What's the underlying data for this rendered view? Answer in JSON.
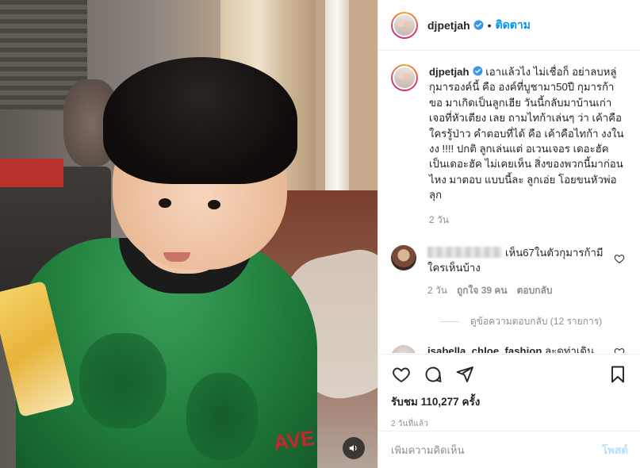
{
  "post": {
    "username": "djpetjah",
    "follow_label": "ติดตาม",
    "separator": "•",
    "caption": "เอาแล้วไง ไม่เชื่อก็ อย่าลบหลู่ กุมารองค์นี้ คือ องค์ที่บูชามา50ปี กุมารก้าขอ มาเกิดเป็นลูกเฮีย วันนี้กลับมาบ้านเก่า เจอที่หัวเตียง เลย ถามไทก้าเล่นๆ ว่า เค้าคือใครรู้ป่าว คำตอบที่ได้ คือ เค้าคือไทก้า งงในงง !!!! ปกติ ลูกเล่นแต่ อเวนเจอร เดอะฮัค เป็นเดอะฮัค ไม่เคยเห็น สิ่งของพวกนี้มาก่อน ไหง มาตอบ แบบนี้ละ ลูกเอ่ย โอยขนหัวพ่อลุก",
    "caption_age": "2 วัน"
  },
  "comments": [
    {
      "username_hidden": true,
      "text": "เห็น67ในตัวกุมารก้ามีใครเห็นบ้าง",
      "age": "2 วัน",
      "likes": "ถูกใจ 39 คน",
      "reply_label": "ตอบกลับ",
      "view_replies": "ดูข้อความตอบกลับ (12 รายการ)"
    },
    {
      "username": "isabella_chloe_fashion",
      "text": "ละดท่าเดิน"
    }
  ],
  "actions": {
    "like_icon": "heart-icon",
    "comment_icon": "comment-icon",
    "share_icon": "share-icon",
    "save_icon": "bookmark-icon",
    "views_text": "รับชม 110,277 ครั้ง",
    "timestamp": "2 วันที่แล้ว"
  },
  "composer": {
    "placeholder": "เพิ่มความคิดเห็น",
    "post_label": "โพสต์"
  },
  "media": {
    "shirt_text": "AVE",
    "sound_icon": "speaker-icon"
  },
  "colors": {
    "accent": "#0095f6",
    "post_disabled": "#b2dffc",
    "muted": "#8e8e8e",
    "text": "#262626"
  }
}
